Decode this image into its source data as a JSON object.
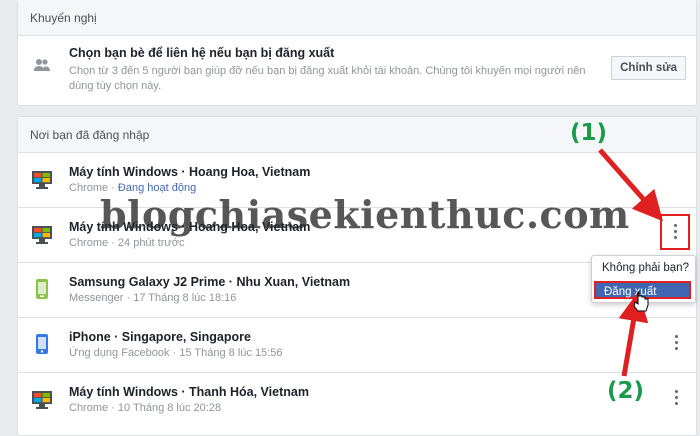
{
  "recommendation": {
    "header": "Khuyến nghị",
    "title": "Chọn bạn bè để liên hệ nếu bạn bị đăng xuất",
    "description": "Chọn từ 3 đến 5 người bạn giúp đỡ nếu bạn bị đăng xuất khỏi tài khoản. Chúng tôi khuyến mọi người nên dùng tùy chọn này.",
    "button": "Chỉnh sửa"
  },
  "logins": {
    "header": "Nơi bạn đã đăng nhập",
    "sessions": [
      {
        "icon": "windows-computer-icon",
        "title": "Máy tính Windows · Hoang Hoa, Vietnam",
        "app": "Chrome",
        "time": "Đang hoạt động"
      },
      {
        "icon": "windows-computer-icon",
        "title": "Máy tính Windows · Hoang Hoa, Vietnam",
        "app": "Chrome",
        "time": "24 phút trước"
      },
      {
        "icon": "android-phone-icon",
        "title": "Samsung Galaxy J2 Prime · Nhu Xuan, Vietnam",
        "app": "Messenger",
        "time": "17 Tháng 8 lúc 18:16"
      },
      {
        "icon": "iphone-icon",
        "title": "iPhone · Singapore, Singapore",
        "app": "Ứng dụng Facebook",
        "time": "15 Tháng 8 lúc 15:56"
      },
      {
        "icon": "windows-computer-icon",
        "title": "Máy tính Windows · Thanh Hóa, Vietnam",
        "app": "Chrome",
        "time": "10 Tháng 8 lúc 20:28"
      }
    ],
    "separator": " · "
  },
  "context_menu": {
    "items": [
      "Không phải bạn?",
      "Đăng xuất"
    ]
  },
  "annotations": {
    "step1": "(1)",
    "step2": "(2)",
    "watermark": "blogchiasekienthuc.com"
  },
  "colors": {
    "accent": "#4267b2",
    "annotation_green": "#1b9a4b",
    "annotation_red": "#e02020"
  }
}
